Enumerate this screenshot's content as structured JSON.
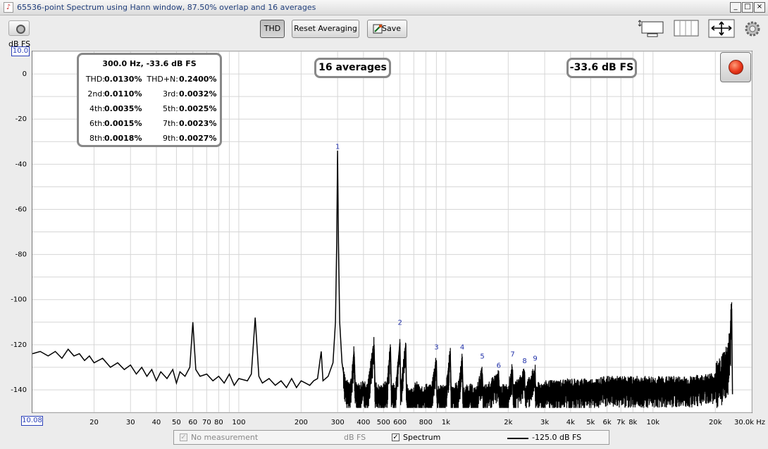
{
  "window": {
    "title": "65536-point Spectrum using Hann window, 87.50% overlap and 16 averages",
    "minimize": "_",
    "maximize": "□",
    "close": "×"
  },
  "toolbar": {
    "thd_label": "THD",
    "reset_label": "Reset Averaging",
    "save_label": "Save",
    "icons": [
      "camera-icon",
      "save-icon",
      "zoom-region-icon",
      "columns-icon",
      "pan-arrows-icon",
      "settings-gear-icon"
    ]
  },
  "y_unit": "dB FS",
  "y_top_value": "10.0",
  "x_left_value": "10.08",
  "thd_panel": {
    "header": "300.0 Hz, -33.6 dB FS",
    "rows": [
      {
        "l1": "THD:",
        "v1": "0.0130%",
        "l2": "THD+N:",
        "v2": "0.2400%"
      },
      {
        "l1": "2nd:",
        "v1": "0.0110%",
        "l2": "3rd:",
        "v2": "0.0032%"
      },
      {
        "l1": "4th:",
        "v1": "0.0035%",
        "l2": "5th:",
        "v2": "0.0025%"
      },
      {
        "l1": "6th:",
        "v1": "0.0015%",
        "l2": "7th:",
        "v2": "0.0023%"
      },
      {
        "l1": "8th:",
        "v1": "0.0018%",
        "l2": "9th:",
        "v2": "0.0027%"
      }
    ]
  },
  "averages_label": "16 averages",
  "level_label": "-33.6 dB FS",
  "legend": {
    "no_measurement": "No measurement",
    "unit": "dB FS",
    "spectrum": "Spectrum",
    "level": "-125.0 dB FS",
    "spectrum_checked": "✓",
    "no_measurement_checked": "✓"
  },
  "colors": {
    "trace": "#000000",
    "grid": "#d0d0d0",
    "marker_text": "#1f2fa8",
    "axis_box": "#2a3fb8",
    "record_button": "#e8361a"
  },
  "chart_data": {
    "type": "line",
    "xscale": "log",
    "xlabel": "Hz",
    "ylabel": "dB FS",
    "xlim": [
      10.08,
      30000
    ],
    "ylim": [
      -150,
      10
    ],
    "yticks": [
      0,
      -20,
      -40,
      -60,
      -80,
      -100,
      -120,
      -140
    ],
    "xticks": [
      {
        "v": 20,
        "l": "20"
      },
      {
        "v": 30,
        "l": "30"
      },
      {
        "v": 40,
        "l": "40"
      },
      {
        "v": 50,
        "l": "50"
      },
      {
        "v": 60,
        "l": "60"
      },
      {
        "v": 70,
        "l": "70"
      },
      {
        "v": 80,
        "l": "80"
      },
      {
        "v": 100,
        "l": "100"
      },
      {
        "v": 200,
        "l": "200"
      },
      {
        "v": 300,
        "l": "300"
      },
      {
        "v": 400,
        "l": "400"
      },
      {
        "v": 500,
        "l": "500"
      },
      {
        "v": 600,
        "l": "600"
      },
      {
        "v": 800,
        "l": "800"
      },
      {
        "v": 1000,
        "l": "1k"
      },
      {
        "v": 2000,
        "l": "2k"
      },
      {
        "v": 3000,
        "l": "3k"
      },
      {
        "v": 4000,
        "l": "4k"
      },
      {
        "v": 5000,
        "l": "5k"
      },
      {
        "v": 6000,
        "l": "6k"
      },
      {
        "v": 7000,
        "l": "7k"
      },
      {
        "v": 8000,
        "l": "8k"
      },
      {
        "v": 10000,
        "l": "10k"
      },
      {
        "v": 20000,
        "l": "20k"
      },
      {
        "v": 30000,
        "l": "30.0k Hz"
      }
    ],
    "grid": true,
    "fundamental": {
      "freq": 300.0,
      "level": -33.6
    },
    "harmonic_markers": [
      {
        "n": "1",
        "freq": 300,
        "level": -35
      },
      {
        "n": "2",
        "freq": 600,
        "level": -113
      },
      {
        "n": "3",
        "freq": 900,
        "level": -124
      },
      {
        "n": "4",
        "freq": 1200,
        "level": -124
      },
      {
        "n": "5",
        "freq": 1500,
        "level": -128
      },
      {
        "n": "6",
        "freq": 1800,
        "level": -132
      },
      {
        "n": "7",
        "freq": 2100,
        "level": -127
      },
      {
        "n": "8",
        "freq": 2400,
        "level": -130
      },
      {
        "n": "9",
        "freq": 2700,
        "level": -129
      }
    ],
    "spectrum_points": [
      [
        10.08,
        -124
      ],
      [
        11,
        -123
      ],
      [
        12,
        -125
      ],
      [
        13,
        -123
      ],
      [
        14,
        -126
      ],
      [
        15,
        -122
      ],
      [
        16,
        -125
      ],
      [
        17,
        -124
      ],
      [
        18,
        -127
      ],
      [
        19,
        -125
      ],
      [
        20,
        -128
      ],
      [
        22,
        -126
      ],
      [
        24,
        -130
      ],
      [
        26,
        -128
      ],
      [
        28,
        -131
      ],
      [
        30,
        -129
      ],
      [
        32,
        -133
      ],
      [
        34,
        -130
      ],
      [
        36,
        -134
      ],
      [
        38,
        -131
      ],
      [
        40,
        -136
      ],
      [
        42,
        -132
      ],
      [
        45,
        -135
      ],
      [
        48,
        -131
      ],
      [
        50,
        -137
      ],
      [
        52,
        -132
      ],
      [
        55,
        -134
      ],
      [
        58,
        -130
      ],
      [
        60,
        -110
      ],
      [
        62,
        -131
      ],
      [
        65,
        -134
      ],
      [
        70,
        -133
      ],
      [
        75,
        -136
      ],
      [
        80,
        -134
      ],
      [
        85,
        -137
      ],
      [
        90,
        -133
      ],
      [
        95,
        -138
      ],
      [
        100,
        -135
      ],
      [
        110,
        -136
      ],
      [
        115,
        -133
      ],
      [
        120,
        -108
      ],
      [
        125,
        -134
      ],
      [
        130,
        -137
      ],
      [
        140,
        -135
      ],
      [
        150,
        -138
      ],
      [
        160,
        -136
      ],
      [
        170,
        -139
      ],
      [
        180,
        -135
      ],
      [
        190,
        -139
      ],
      [
        200,
        -136
      ],
      [
        210,
        -137
      ],
      [
        220,
        -138
      ],
      [
        230,
        -136
      ],
      [
        240,
        -135
      ],
      [
        250,
        -123
      ],
      [
        255,
        -136
      ],
      [
        270,
        -134
      ],
      [
        285,
        -128
      ],
      [
        293,
        -110
      ],
      [
        297,
        -75
      ],
      [
        300,
        -34
      ],
      [
        303,
        -75
      ],
      [
        307,
        -110
      ],
      [
        315,
        -128
      ],
      [
        330,
        -140
      ],
      [
        350,
        -138
      ],
      [
        360,
        -123
      ],
      [
        365,
        -139
      ],
      [
        380,
        -141
      ],
      [
        400,
        -139
      ],
      [
        420,
        -140
      ],
      [
        450,
        -120
      ],
      [
        455,
        -140
      ],
      [
        480,
        -142
      ],
      [
        500,
        -141
      ],
      [
        520,
        -139
      ],
      [
        540,
        -121
      ],
      [
        545,
        -140
      ],
      [
        570,
        -142
      ],
      [
        600,
        -119
      ],
      [
        605,
        -141
      ],
      [
        640,
        -120
      ],
      [
        645,
        -141
      ],
      [
        680,
        -143
      ],
      [
        720,
        -140
      ],
      [
        760,
        -143
      ],
      [
        800,
        -141
      ],
      [
        850,
        -142
      ],
      [
        900,
        -127
      ],
      [
        905,
        -143
      ],
      [
        950,
        -141
      ],
      [
        1000,
        -142
      ],
      [
        1050,
        -124
      ],
      [
        1060,
        -142
      ],
      [
        1150,
        -140
      ],
      [
        1200,
        -127
      ],
      [
        1210,
        -143
      ],
      [
        1300,
        -141
      ],
      [
        1400,
        -143
      ],
      [
        1500,
        -133
      ],
      [
        1510,
        -142
      ],
      [
        1600,
        -141
      ],
      [
        1800,
        -135
      ],
      [
        1810,
        -142
      ],
      [
        2000,
        -141
      ],
      [
        2100,
        -131
      ],
      [
        2110,
        -142
      ],
      [
        2400,
        -134
      ],
      [
        2410,
        -141
      ],
      [
        2700,
        -133
      ],
      [
        2710,
        -141
      ],
      [
        3000,
        -140
      ],
      [
        4000,
        -139
      ],
      [
        5000,
        -139
      ],
      [
        6000,
        -138
      ],
      [
        8000,
        -138
      ],
      [
        10000,
        -138
      ],
      [
        12000,
        -138
      ],
      [
        15000,
        -138
      ],
      [
        18000,
        -137
      ],
      [
        20000,
        -136
      ],
      [
        21000,
        -134
      ],
      [
        22000,
        -130
      ],
      [
        23000,
        -126
      ],
      [
        23500,
        -120
      ],
      [
        24000,
        -104
      ],
      [
        24200,
        -142
      ]
    ]
  }
}
